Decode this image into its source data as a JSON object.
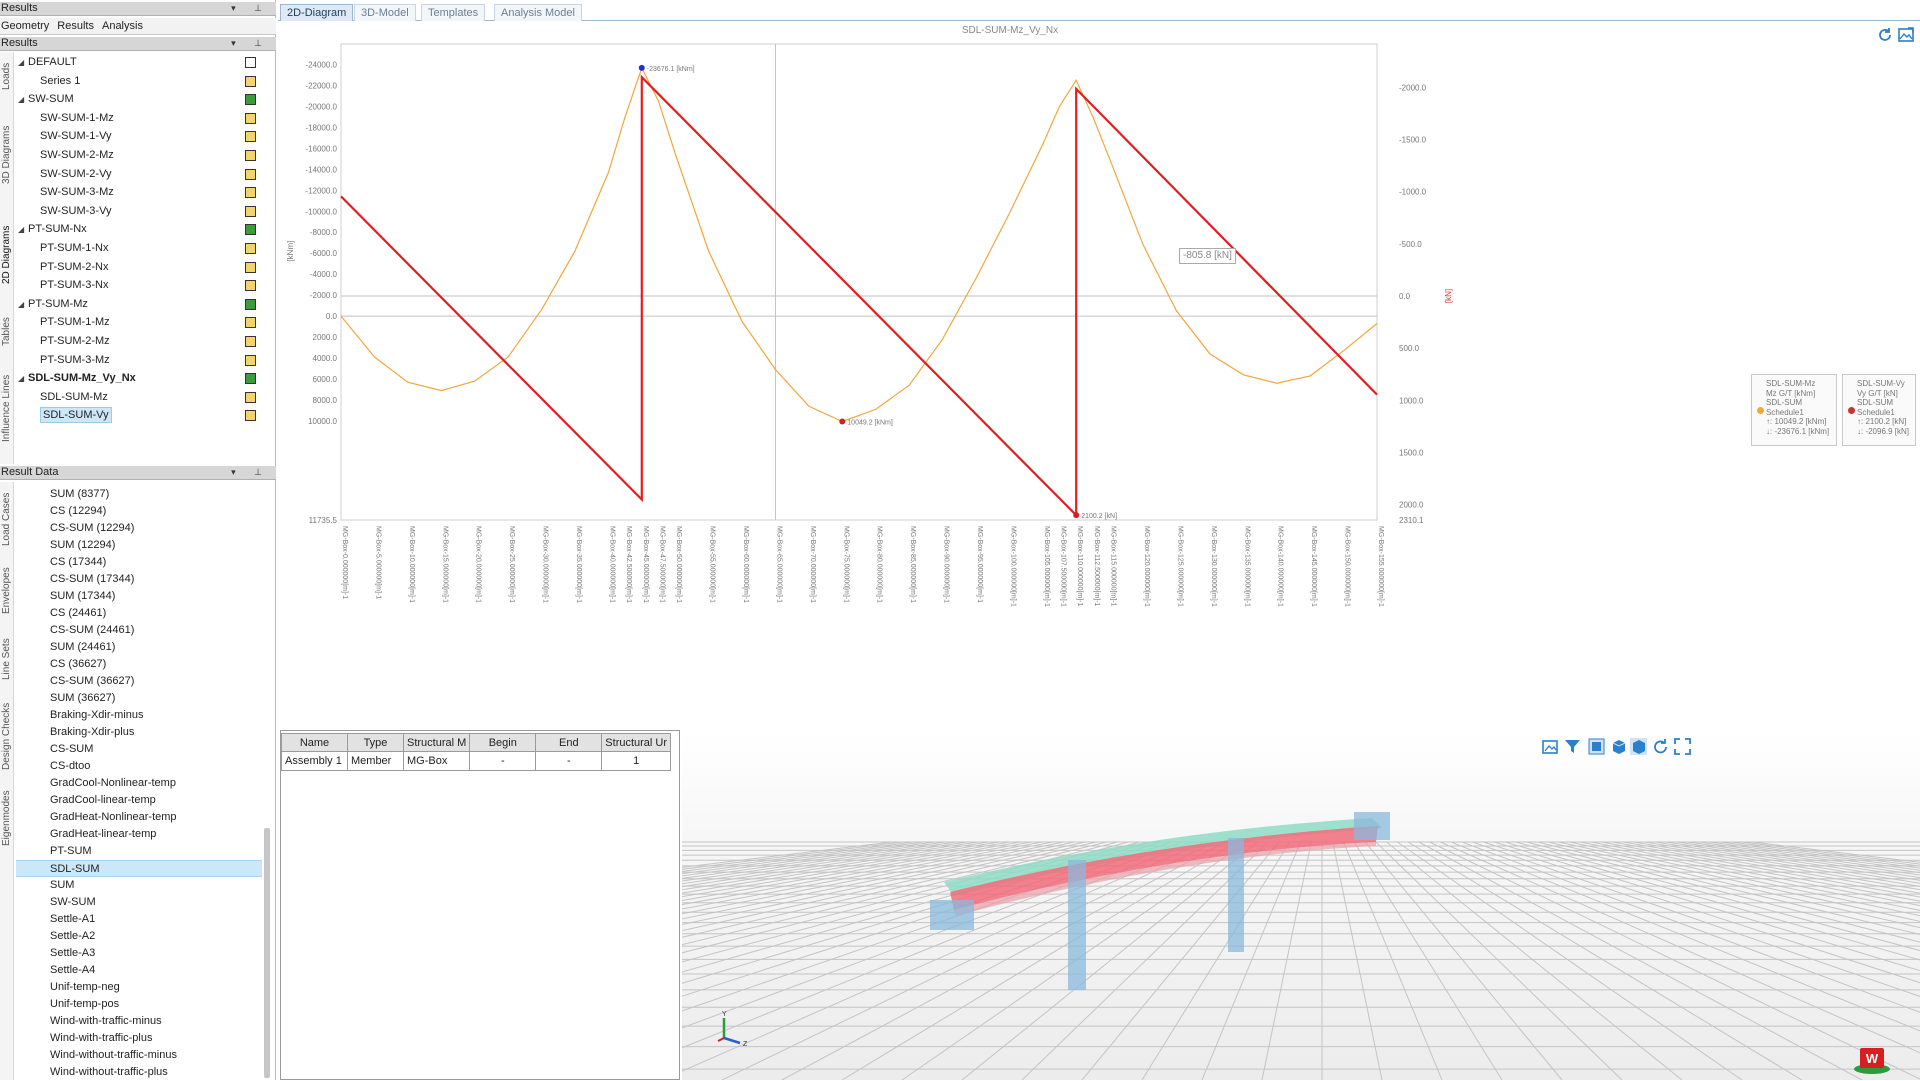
{
  "left": {
    "results_header": "Results",
    "top_tabs": [
      "Geometry",
      "Results",
      "Analysis"
    ],
    "results_sub_header": "Results",
    "vtabs_upper": [
      "Loads",
      "3D Diagrams",
      "2D Diagrams",
      "Tables",
      "Influence Lines"
    ],
    "tree": [
      {
        "label": "DEFAULT",
        "level": 0,
        "expanded": true,
        "box": "#ffffff",
        "bold": false,
        "selected": false
      },
      {
        "label": "Series 1",
        "level": 1,
        "box": "#f3d36b",
        "bold": false,
        "selected": false
      },
      {
        "label": "SW-SUM",
        "level": 0,
        "expanded": true,
        "box": "#3a9c3a",
        "bold": false,
        "selected": false
      },
      {
        "label": "SW-SUM-1-Mz",
        "level": 1,
        "box": "#f3d36b",
        "bold": false,
        "selected": false
      },
      {
        "label": "SW-SUM-1-Vy",
        "level": 1,
        "box": "#f3d36b",
        "bold": false,
        "selected": false
      },
      {
        "label": "SW-SUM-2-Mz",
        "level": 1,
        "box": "#f3d36b",
        "bold": false,
        "selected": false
      },
      {
        "label": "SW-SUM-2-Vy",
        "level": 1,
        "box": "#f3d36b",
        "bold": false,
        "selected": false
      },
      {
        "label": "SW-SUM-3-Mz",
        "level": 1,
        "box": "#f3d36b",
        "bold": false,
        "selected": false
      },
      {
        "label": "SW-SUM-3-Vy",
        "level": 1,
        "box": "#f3d36b",
        "bold": false,
        "selected": false
      },
      {
        "label": "PT-SUM-Nx",
        "level": 0,
        "expanded": true,
        "box": "#3a9c3a",
        "bold": false,
        "selected": false
      },
      {
        "label": "PT-SUM-1-Nx",
        "level": 1,
        "box": "#f3d36b",
        "bold": false,
        "selected": false
      },
      {
        "label": "PT-SUM-2-Nx",
        "level": 1,
        "box": "#f3d36b",
        "bold": false,
        "selected": false
      },
      {
        "label": "PT-SUM-3-Nx",
        "level": 1,
        "box": "#f3d36b",
        "bold": false,
        "selected": false
      },
      {
        "label": "PT-SUM-Mz",
        "level": 0,
        "expanded": true,
        "box": "#3a9c3a",
        "bold": false,
        "selected": false
      },
      {
        "label": "PT-SUM-1-Mz",
        "level": 1,
        "box": "#f3d36b",
        "bold": false,
        "selected": false
      },
      {
        "label": "PT-SUM-2-Mz",
        "level": 1,
        "box": "#f3d36b",
        "bold": false,
        "selected": false
      },
      {
        "label": "PT-SUM-3-Mz",
        "level": 1,
        "box": "#f3d36b",
        "bold": false,
        "selected": false
      },
      {
        "label": "SDL-SUM-Mz_Vy_Nx",
        "level": 0,
        "expanded": true,
        "box": "#3a9c3a",
        "bold": true,
        "selected": false
      },
      {
        "label": "SDL-SUM-Mz",
        "level": 1,
        "box": "#f3d36b",
        "bold": false,
        "selected": false
      },
      {
        "label": "SDL-SUM-Vy",
        "level": 1,
        "box": "#f3d36b",
        "bold": false,
        "selected": true
      }
    ],
    "result_data_header": "Result Data",
    "vtabs_lower": [
      "Load Cases",
      "Envelopes",
      "Line Sets",
      "Design Checks",
      "Eigenmodes"
    ],
    "result_data": [
      "SUM (8377)",
      "CS (12294)",
      "CS-SUM (12294)",
      "SUM (12294)",
      "CS (17344)",
      "CS-SUM (17344)",
      "SUM (17344)",
      "CS (24461)",
      "CS-SUM (24461)",
      "SUM (24461)",
      "CS (36627)",
      "CS-SUM (36627)",
      "SUM (36627)",
      "Braking-Xdir-minus",
      "Braking-Xdir-plus",
      "CS-SUM",
      "CS-dtoo",
      "GradCool-Nonlinear-temp",
      "GradCool-linear-temp",
      "GradHeat-Nonlinear-temp",
      "GradHeat-linear-temp",
      "PT-SUM",
      "SDL-SUM",
      "SUM",
      "SW-SUM",
      "Settle-A1",
      "Settle-A2",
      "Settle-A3",
      "Settle-A4",
      "Unif-temp-neg",
      "Unif-temp-pos",
      "Wind-with-traffic-minus",
      "Wind-with-traffic-plus",
      "Wind-without-traffic-minus",
      "Wind-without-traffic-plus"
    ],
    "result_data_selected": "SDL-SUM"
  },
  "doc_tabs": [
    {
      "label": "2D-Diagram",
      "active": true
    },
    {
      "label": "3D-Model",
      "active": false
    },
    {
      "label": "Templates",
      "active": false
    },
    {
      "label": "Analysis Model",
      "active": false
    }
  ],
  "chart_data": {
    "type": "line",
    "title": "SDL-SUM-Mz_Vy_Nx",
    "ylabel_left": "[kNm]",
    "ylabel_right": "[kN]",
    "left_axis_ticks": [
      "-24000.0",
      "-22000.0",
      "-20000.0",
      "-18000.0",
      "-16000.0",
      "-14000.0",
      "-12000.0",
      "-10000.0",
      "-8000.0",
      "-6000.0",
      "-4000.0",
      "-2000.0",
      "0.0",
      "2000.0",
      "4000.0",
      "6000.0",
      "8000.0",
      "10000.0",
      "11735.5"
    ],
    "right_axis_ticks": [
      "-2000.0",
      "-1500.0",
      "-1000.0",
      "-500.0",
      "0.0",
      "500.0",
      "1000.0",
      "1500.0",
      "2000.0",
      "2310.1"
    ],
    "x_labels": [
      "MG-Box-0.000000[m]-1",
      "MG-Box-5.000000[m]-1",
      "MG-Box-10.000000[m]-1",
      "MG-Box-15.000000[m]-1",
      "MG-Box-20.000000[m]-1",
      "MG-Box-25.000000[m]-1",
      "MG-Box-30.000000[m]-1",
      "MG-Box-35.000000[m]-1",
      "MG-Box-40.000000[m]-1",
      "MG-Box-42.500000[m]-1",
      "MG-Box-45.000000[m]-1",
      "MG-Box-47.500000[m]-1",
      "MG-Box-50.000000[m]-1",
      "MG-Box-55.000000[m]-1",
      "MG-Box-60.000000[m]-1",
      "MG-Box-65.000000[m]-1",
      "MG-Box-70.000000[m]-1",
      "MG-Box-75.000000[m]-1",
      "MG-Box-80.000000[m]-1",
      "MG-Box-85.000000[m]-1",
      "MG-Box-90.000000[m]-1",
      "MG-Box-95.000000[m]-1",
      "MG-Box-100.000000[m]-1",
      "MG-Box-105.000000[m]-1",
      "MG-Box-107.500000[m]-1",
      "MG-Box-110.000000[m]-1",
      "MG-Box-112.500000[m]-1",
      "MG-Box-115.000000[m]-1",
      "MG-Box-120.000000[m]-1",
      "MG-Box-125.000000[m]-1",
      "MG-Box-130.000000[m]-1",
      "MG-Box-135.000000[m]-1",
      "MG-Box-140.000000[m]-1",
      "MG-Box-145.000000[m]-1",
      "MG-Box-150.000000[m]-1",
      "MG-Box-155.000000[m]-1"
    ],
    "series": [
      {
        "name": "SDL-SUM-Mz",
        "axis": "left",
        "color": "#f2a63b",
        "x": [
          0,
          5,
          10,
          15,
          20,
          25,
          30,
          35,
          40,
          42.5,
          45,
          47.5,
          50,
          55,
          60,
          65,
          70,
          75,
          80,
          85,
          90,
          95,
          100,
          105,
          107.5,
          110,
          112.5,
          115,
          120,
          125,
          130,
          135,
          140,
          145,
          150,
          155
        ],
        "y": [
          0,
          3900,
          6300,
          7100,
          6200,
          3900,
          -600,
          -6200,
          -13700,
          -19000,
          -23676.1,
          -20500,
          -15500,
          -6200,
          500,
          5100,
          8600,
          10049.2,
          8900,
          6600,
          2200,
          -3600,
          -9800,
          -16400,
          -20000,
          -22500,
          -19000,
          -15000,
          -6800,
          -500,
          3600,
          5600,
          6400,
          5700,
          3300,
          700
        ]
      },
      {
        "name": "SDL-SUM-Vy",
        "axis": "right",
        "color": "#e02020",
        "x": [
          0,
          45,
          45,
          110,
          110,
          155
        ],
        "y": [
          -954.4,
          1950,
          -2096.9,
          2100.2,
          -1985,
          945
        ]
      }
    ],
    "data_labels": [
      {
        "text": "-23676.1 [kNm]",
        "series": "SDL-SUM-Mz"
      },
      {
        "text": "10049.2 [kNm]",
        "series": "SDL-SUM-Mz"
      },
      {
        "text": "2100.2 [kN]",
        "series": "SDL-SUM-Vy"
      }
    ],
    "cursor_readout": "-805.8 [kN]",
    "legend": [
      {
        "title1": "SDL-SUM-Mz",
        "title2": "Mz G/T [kNm]",
        "case1": "SDL-SUM",
        "case2": "Schedule1",
        "max": "↑: 10049.2 [kNm]",
        "min": "↓: -23676.1 [kNm]",
        "color": "#f2a63b"
      },
      {
        "title1": "SDL-SUM-Vy",
        "title2": "Vy G/T [kN]",
        "case1": "SDL-SUM",
        "case2": "Schedule1",
        "max": "↑: 2100.2 [kN]",
        "min": "↓: -2096.9 [kN]",
        "color": "#c0392b"
      }
    ],
    "legend_position": "right"
  },
  "table": {
    "headers": [
      "Name",
      "Type",
      "Structural M",
      "Begin",
      "End",
      "Structural Ur"
    ],
    "rows": [
      [
        "Assembly 1",
        "Member",
        "MG-Box",
        "-",
        "-",
        "1"
      ]
    ]
  },
  "view3d": {
    "toolbar_icons": [
      "screenshot-icon",
      "filter-icon",
      "front-view-icon",
      "box-view-icon",
      "iso-view-icon",
      "rotate-icon",
      "fullscreen-icon"
    ],
    "axes": [
      "Y",
      "Z"
    ],
    "logo": "W"
  }
}
